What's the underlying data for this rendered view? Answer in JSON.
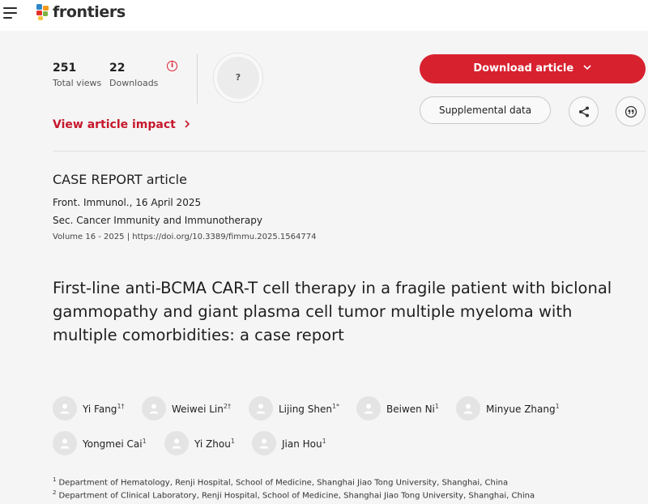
{
  "header": {
    "logo_text": "frontiers",
    "menu_icon": "hamburger-menu-icon"
  },
  "stats": {
    "views_count": "251",
    "views_label": "Total views",
    "downloads_count": "22",
    "downloads_label": "Downloads",
    "info_glyph": "i",
    "altmetric_glyph": "?"
  },
  "impact_link": "View article impact",
  "actions": {
    "download_label": "Download article",
    "supplemental_label": "Supplemental data"
  },
  "article": {
    "type": "CASE REPORT article",
    "journal_date": "Front. Immunol., 16 April 2025",
    "section": "Sec. Cancer Immunity and Immunotherapy",
    "volume_doi": "Volume 16 - 2025 | https://doi.org/10.3389/fimmu.2025.1564774",
    "title_lines": [
      "First-line anti-BCMA CAR-T cell therapy in a fragile patient with biclonal",
      "gammopathy and giant plasma cell tumor multiple myeloma with",
      "multiple comorbidities: a case report"
    ]
  },
  "authors": [
    {
      "name": "Yi Fang",
      "sup": "1†"
    },
    {
      "name": "Weiwei Lin",
      "sup": "2†"
    },
    {
      "name": "Lijing Shen",
      "sup": "1*"
    },
    {
      "name": "Beiwen Ni",
      "sup": "1"
    },
    {
      "name": "Minyue Zhang",
      "sup": "1"
    },
    {
      "name": "Yongmei Cai",
      "sup": "1"
    },
    {
      "name": "Yi Zhou",
      "sup": "1"
    },
    {
      "name": "Jian Hou",
      "sup": "1"
    }
  ],
  "affiliations": [
    {
      "num": "1",
      "text": "Department of Hematology, Renji Hospital, School of Medicine, Shanghai Jiao Tong University, Shanghai, China"
    },
    {
      "num": "2",
      "text": "Department of Clinical Laboratory, Renji Hospital, School of Medicine, Shanghai Jiao Tong University, Shanghai, China"
    }
  ],
  "colors": {
    "accent": "#d8212f",
    "link": "#c6172b",
    "background": "#f5f5f5"
  }
}
